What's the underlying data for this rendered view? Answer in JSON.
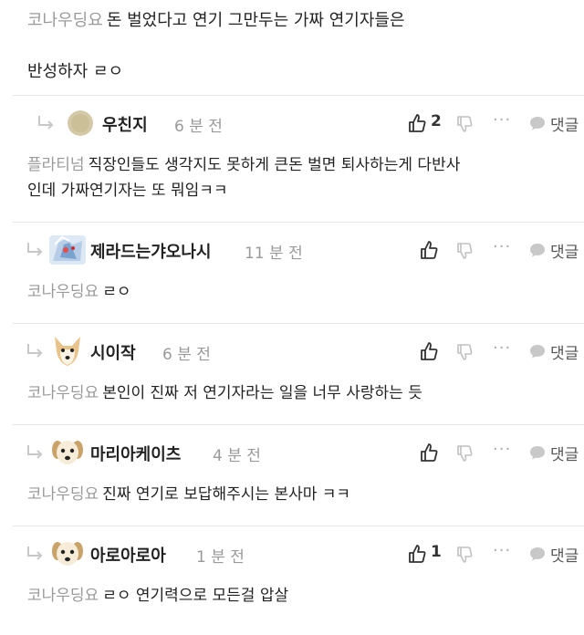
{
  "post": {
    "author": "코나우딩요",
    "text_line1": "돈 벌었다고 연기 그만두는 가짜 연기자들은",
    "text_line2": "반성하자 ㄹㅇ"
  },
  "reply_label": "댓글",
  "more_label": "···",
  "replies": [
    {
      "username": "우친지",
      "time": "6 분 전",
      "likes": "2",
      "mention": "플라티넘",
      "text_line1": "직장인들도 생각지도 못하게 큰돈 벌면 퇴사하는게 다반사",
      "text_line2": "인데 가짜연기자는 또 뭐임ㅋㅋ"
    },
    {
      "username": "제라드는갸오나시",
      "time": "11 분 전",
      "likes": "",
      "mention": "코나우딩요",
      "text_line1": "ㄹㅇ"
    },
    {
      "username": "시이작",
      "time": "6 분 전",
      "likes": "",
      "mention": "코나우딩요",
      "text_line1": "본인이 진짜 저 연기자라는 일을 너무 사랑하는 듯"
    },
    {
      "username": "마리아케이츠",
      "time": "4 분 전",
      "likes": "",
      "mention": "코나우딩요",
      "text_line1": "진짜 연기로 보답해주시는 본사마 ㅋㅋ"
    },
    {
      "username": "아로아로아",
      "time": "1 분 전",
      "likes": "1",
      "mention": "코나우딩요",
      "text_line1": "ㄹㅇ 연기력으로 모든걸 압살"
    }
  ]
}
